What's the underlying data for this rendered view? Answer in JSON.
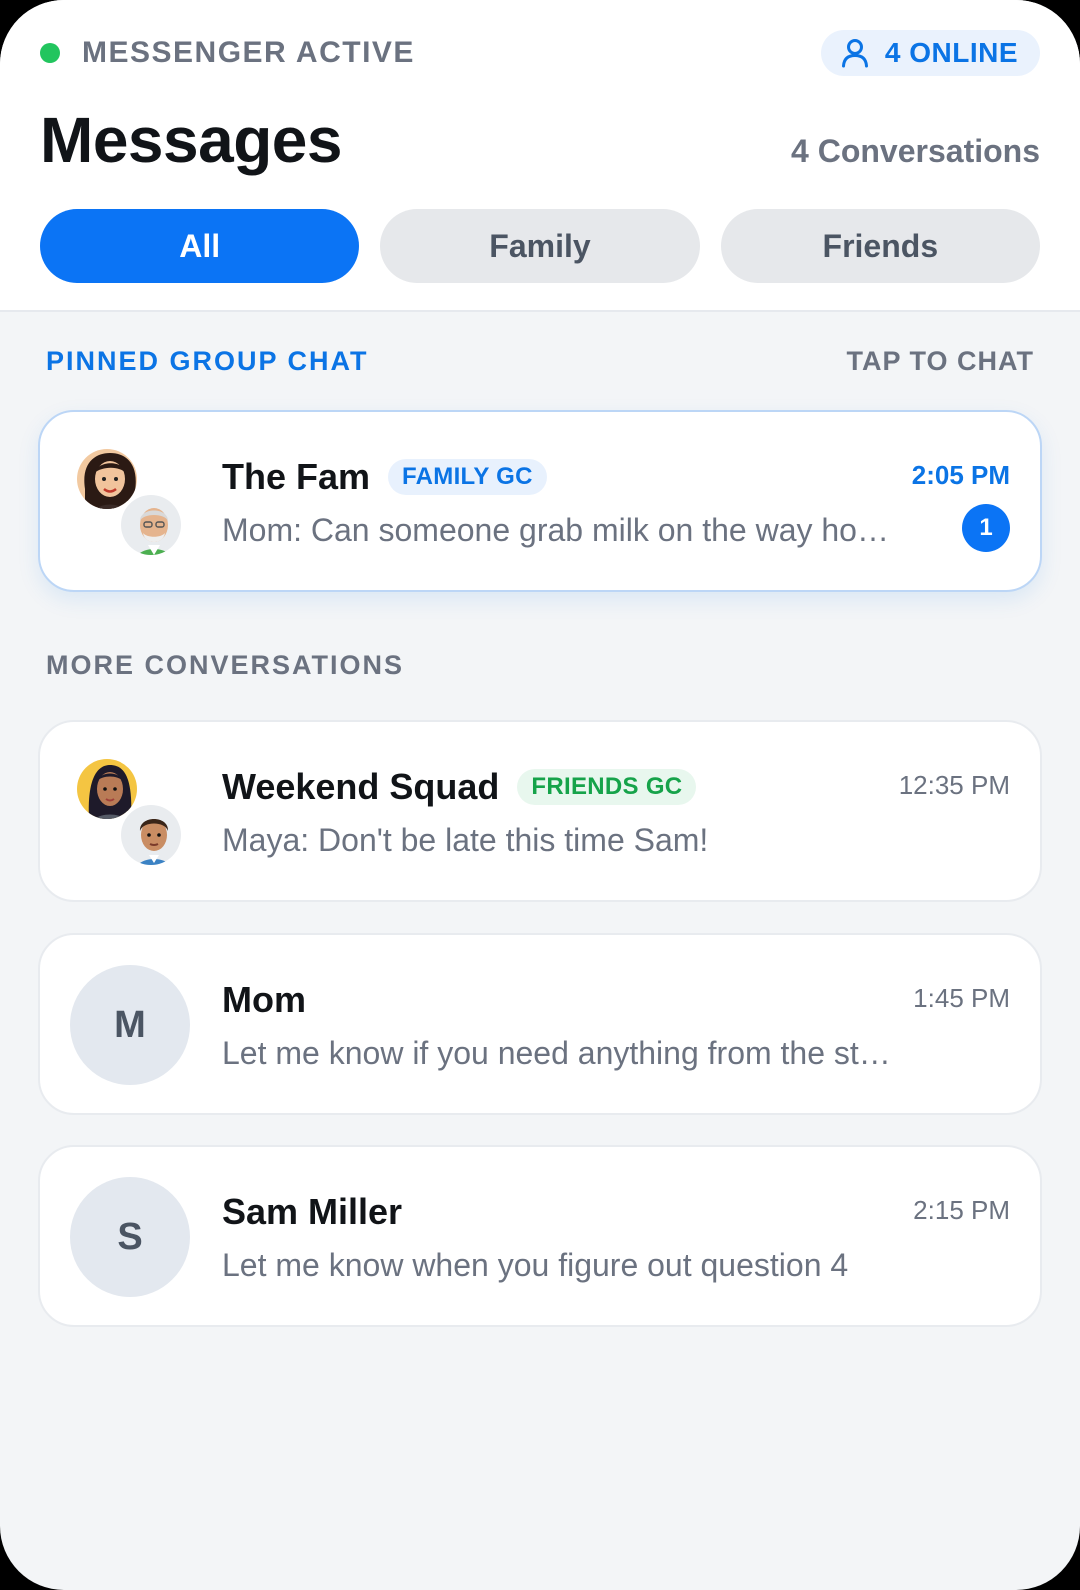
{
  "status": {
    "label": "MESSENGER ACTIVE",
    "online": "4 ONLINE",
    "colors": {
      "active_dot": "#22c55e",
      "accent": "#0b74f5"
    }
  },
  "header": {
    "title": "Messages",
    "count": "4 Conversations"
  },
  "tabs": [
    {
      "label": "All",
      "active": true
    },
    {
      "label": "Family",
      "active": false
    },
    {
      "label": "Friends",
      "active": false
    }
  ],
  "pinned": {
    "heading": "PINNED GROUP CHAT",
    "action": "TAP TO CHAT",
    "chat": {
      "name": "The Fam",
      "tag": "FAMILY GC",
      "time": "2:05 PM",
      "preview": "Mom: Can someone grab milk on the way home?",
      "unread": "1",
      "avatars": [
        "woman-avatar",
        "grandpa-avatar"
      ]
    }
  },
  "more": {
    "heading": "MORE CONVERSATIONS",
    "chats": [
      {
        "name": "Weekend Squad",
        "tag": "FRIENDS GC",
        "time": "12:35 PM",
        "preview": "Maya: Don't be late this time Sam!",
        "avatars": [
          "maya-avatar",
          "sam-avatar"
        ]
      },
      {
        "name": "Mom",
        "initial": "M",
        "time": "1:45 PM",
        "preview": "Let me know if you need anything from the store"
      },
      {
        "name": "Sam Miller",
        "initial": "S",
        "time": "2:15 PM",
        "preview": "Let me know when you figure out question 4"
      }
    ]
  }
}
